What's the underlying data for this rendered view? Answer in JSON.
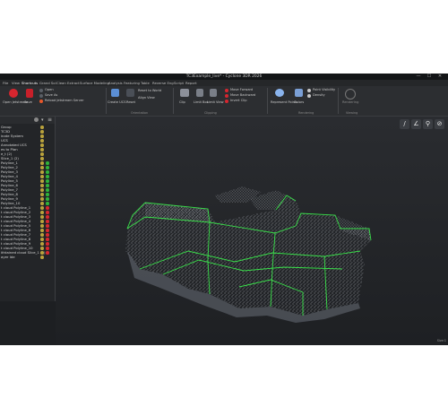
{
  "window": {
    "title": "TC3Example_live* - Cyclone 3DR 2026",
    "controls": [
      "—",
      "☐",
      "✕"
    ]
  },
  "menu": {
    "items": [
      "File",
      "View",
      "Shortcuts",
      "Grand Sol",
      "Clean",
      "Extract",
      "Surface Modeling",
      "Analysis",
      "Featuring",
      "Table",
      "Reverse Eng",
      "Script",
      "Report"
    ],
    "active_index": 2
  },
  "ribbon": {
    "buttons": [
      {
        "label": "Open",
        "color": "#d7262f"
      },
      {
        "label": "Open Jetstream",
        "color": "#c8202a"
      },
      {
        "label": "Save",
        "color": "#c8202a"
      },
      {
        "label": "Save As",
        "color": "#5a5f66"
      },
      {
        "label": "Reload Jetstream Server",
        "color": "#e8572a"
      },
      {
        "label": "Create UCS",
        "color": "#5b8fd6"
      },
      {
        "label": "Reset",
        "color": "#4a4f57"
      },
      {
        "label": "Reset to World",
        "color": "#4a4f57"
      },
      {
        "label": "Align View",
        "color": "#4a4f57"
      },
      {
        "label": "Clip",
        "color": "#8c9099"
      },
      {
        "label": "Limit Box",
        "color": "#7a7f88"
      },
      {
        "label": "Limit View",
        "color": "#7a7f88"
      },
      {
        "label": "Move Forward",
        "color": "#d7262f"
      },
      {
        "label": "Move Backward",
        "color": "#d7262f"
      },
      {
        "label": "Invert Clip",
        "color": "#d7262f"
      },
      {
        "label": "Represent Points",
        "color": "#8ab4ee"
      },
      {
        "label": "Colors",
        "color": "#7a9fd6"
      },
      {
        "label": "Point Visibility",
        "color": "#c9c9c9"
      },
      {
        "label": "Density",
        "color": "#c9c9c9"
      },
      {
        "label": "Rendering",
        "color": "#777777"
      }
    ],
    "groups": [
      "File",
      "Orientation",
      "Clipping",
      "Rendering",
      "Viewing"
    ]
  },
  "tree": {
    "items": [
      {
        "label": "Group",
        "status": "none"
      },
      {
        "label": "TC3D",
        "status": "none"
      },
      {
        "label": "inate System",
        "status": "none"
      },
      {
        "label": "UCS",
        "status": "none"
      },
      {
        "label": "Annotated UCS",
        "status": "none"
      },
      {
        "label": "es to Plan",
        "status": "none"
      },
      {
        "label": "e_t (2)",
        "status": "none"
      },
      {
        "label": "Slice_1 (2)",
        "status": "none"
      },
      {
        "label": "Polyline_1",
        "status": "green"
      },
      {
        "label": "Polyline_2",
        "status": "green"
      },
      {
        "label": "Polyline_3",
        "status": "green"
      },
      {
        "label": "Polyline_4",
        "status": "green"
      },
      {
        "label": "Polyline_5",
        "status": "green"
      },
      {
        "label": "Polyline_6",
        "status": "green"
      },
      {
        "label": "Polyline_7",
        "status": "green"
      },
      {
        "label": "Polyline_8",
        "status": "green"
      },
      {
        "label": "Polyline_9",
        "status": "green"
      },
      {
        "label": "Polyline_10",
        "status": "green"
      },
      {
        "label": "t cloud Polyline_1",
        "status": "red"
      },
      {
        "label": "t cloud Polyline_2",
        "status": "red"
      },
      {
        "label": "t cloud Polyline_3",
        "status": "red"
      },
      {
        "label": "t cloud Polyline_4",
        "status": "red"
      },
      {
        "label": "t cloud Polyline_5",
        "status": "red"
      },
      {
        "label": "t cloud Polyline_6",
        "status": "red"
      },
      {
        "label": "t cloud Polyline_7",
        "status": "red"
      },
      {
        "label": "t cloud Polyline_8",
        "status": "red"
      },
      {
        "label": "t cloud Polyline_9",
        "status": "red"
      },
      {
        "label": "t cloud Polyline_10",
        "status": "red"
      },
      {
        "label": "ithtained cloud Slice_1 (2)",
        "status": "red"
      },
      {
        "label": "ayer Ide",
        "status": "none"
      }
    ]
  },
  "viewport_tools": [
    "/",
    "∠",
    "⚲",
    "⊘"
  ],
  "statusbar": {
    "text": "Size:1"
  },
  "colors": {
    "accent": "#e0262b",
    "outline": "#39e04a",
    "points": "#c9ced6"
  }
}
